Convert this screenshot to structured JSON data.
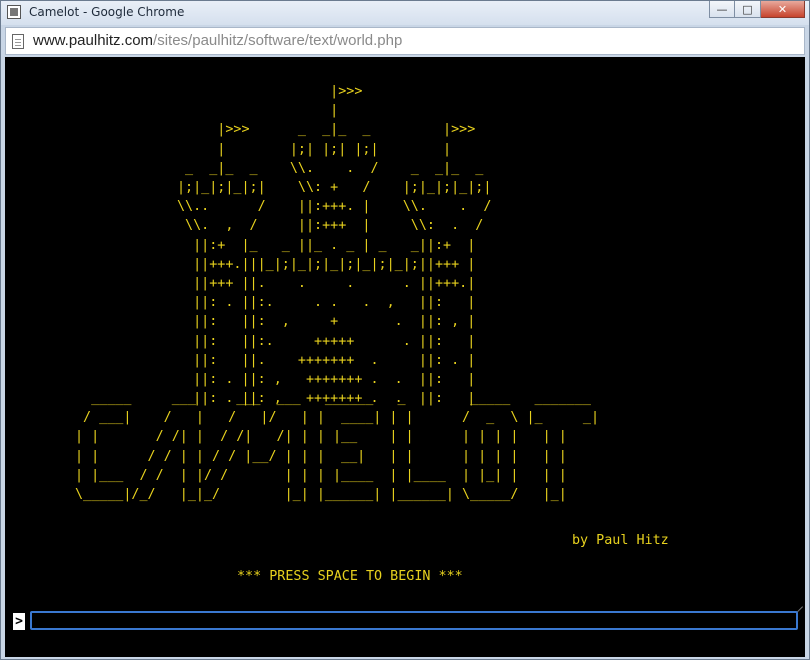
{
  "window": {
    "title": "Camelot - Google Chrome",
    "buttons": {
      "minimize": "—",
      "maximize": "□",
      "close": "✕"
    }
  },
  "address_bar": {
    "host": "www.paulhitz.com",
    "path": "/sites/paulhitz/software/text/world.php",
    "icon": "page-icon"
  },
  "game": {
    "castle_art": "                   |>>>\n                   |\n     |>>>      _  _|_  _         |>>>\n     |        |;| |;| |;|        |\n _  _|_  _    \\\\.    .  /    _  _|_  _\n|;|_|;|_|;|    \\\\: +   /    |;|_|;|_|;|\n\\\\..      /    ||:+++. |    \\\\.    .  /\n \\\\.  ,  /     ||:+++  |     \\\\:  .  /\n  ||:+  |_   _ ||_ . _ | _   _||:+  |\n  ||+++.|||_|;|_|;|_|;|_|;|_|;||+++ |\n  ||+++ ||.    .     .      . ||+++.|\n  ||: . ||:.     . .   .  ,   ||:   |\n  ||:   ||:  ,     +       .  ||: , |\n  ||:   ||:.     +++++      . ||:   |\n  ||:   ||.    +++++++  .     ||: . |\n  ||: . ||: ,   +++++++ .  .  ||:   |\n  ||: . ||: ,   +++++++ .  .  ||:   |",
    "logo_art": "  _____     ___     ___  ___   ______   _        _____   _______\n / ___|    /   |   /   |/   | |  ____| | |      /  _  \\ |_     _|\n| |       / /| |  / /|   /| | | |__    | |      | | | |   | |\n| |      / / | | / / |__/ | | |  __|   | |      | | | |   | |\n| |___  / /  | |/ /       | | | |____  | |____  | |_| |   | |\n\\_____|/_/   |_|_/        |_| |______| |______| \\_____/   |_|",
    "byline": "by Paul Hitz",
    "press_prompt": "*** PRESS SPACE TO BEGIN ***",
    "command_caret": ">",
    "command_value": "",
    "text_color": "#e8d21e",
    "background": "#000000"
  }
}
